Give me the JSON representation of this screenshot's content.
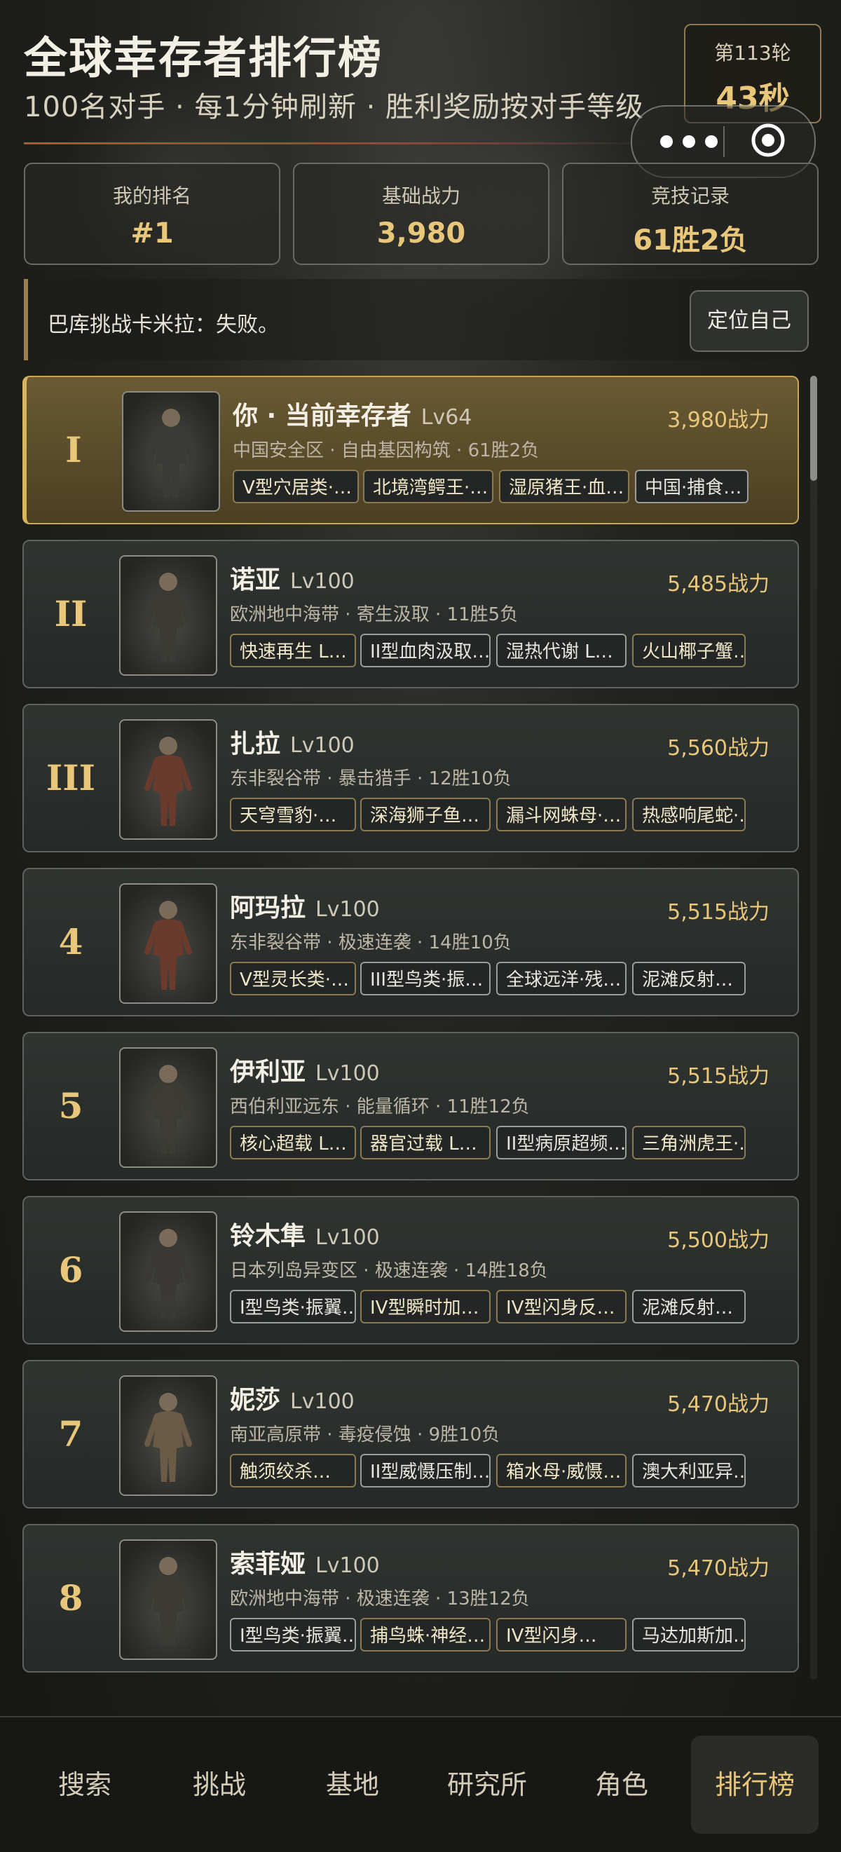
{
  "header": {
    "title": "全球幸存者排行榜",
    "subtitle": "100名对手 · 每1分钟刷新 · 胜利奖励按对手等级",
    "round_label": "第113轮",
    "round_time": "43秒"
  },
  "stats": [
    {
      "label": "我的排名",
      "value": "#1"
    },
    {
      "label": "基础战力",
      "value": "3,980"
    },
    {
      "label": "竞技记录",
      "value": "61胜2负"
    }
  ],
  "battle_log": "巴库挑战卡米拉：失败。",
  "locate_button": "定位自己",
  "entries": [
    {
      "rank": "I",
      "name": "你 · 当前幸存者",
      "level": "Lv64",
      "power": "3,980战力",
      "meta": "中国安全区 · 自由基因构筑 · 61胜2负",
      "tags": [
        {
          "text": "V型穴居类·…",
          "style": "gold"
        },
        {
          "text": "北境湾鳄王·…",
          "style": "gold"
        },
        {
          "text": "湿原猪王·血…",
          "style": "gold"
        },
        {
          "text": "中国·捕食…",
          "style": "silver"
        }
      ]
    },
    {
      "rank": "II",
      "name": "诺亚",
      "level": "Lv100",
      "power": "5,485战力",
      "meta": "欧洲地中海带 · 寄生汲取 · 11胜5负",
      "tags": [
        {
          "text": "快速再生 L…",
          "style": "gold"
        },
        {
          "text": "II型血肉汲取…",
          "style": "silver"
        },
        {
          "text": "湿热代谢 L…",
          "style": "silver"
        },
        {
          "text": "火山椰子蟹…",
          "style": "gold"
        }
      ]
    },
    {
      "rank": "III",
      "name": "扎拉",
      "level": "Lv100",
      "power": "5,560战力",
      "meta": "东非裂谷带 · 暴击猎手 · 12胜10负",
      "tags": [
        {
          "text": "天穹雪豹·…",
          "style": "gold"
        },
        {
          "text": "深海狮子鱼…",
          "style": "gold"
        },
        {
          "text": "漏斗网蛛母·…",
          "style": "gold"
        },
        {
          "text": "热感响尾蛇·…",
          "style": "gold"
        }
      ]
    },
    {
      "rank": "4",
      "name": "阿玛拉",
      "level": "Lv100",
      "power": "5,515战力",
      "meta": "东非裂谷带 · 极速连袭 · 14胜10负",
      "tags": [
        {
          "text": "V型灵长类·…",
          "style": "gold"
        },
        {
          "text": "III型鸟类·振…",
          "style": "silver"
        },
        {
          "text": "全球远洋·残…",
          "style": "silver"
        },
        {
          "text": "泥滩反射…",
          "style": "silver"
        }
      ]
    },
    {
      "rank": "5",
      "name": "伊利亚",
      "level": "Lv100",
      "power": "5,515战力",
      "meta": "西伯利亚远东 · 能量循环 · 11胜12负",
      "tags": [
        {
          "text": "核心超载 L…",
          "style": "gold"
        },
        {
          "text": "器官过载 L…",
          "style": "gold"
        },
        {
          "text": "II型病原超频…",
          "style": "silver"
        },
        {
          "text": "三角洲虎王·…",
          "style": "gold"
        }
      ]
    },
    {
      "rank": "6",
      "name": "铃木隼",
      "level": "Lv100",
      "power": "5,500战力",
      "meta": "日本列岛异变区 · 极速连袭 · 14胜18负",
      "tags": [
        {
          "text": "I型鸟类·振翼…",
          "style": "silver"
        },
        {
          "text": "IV型瞬时加…",
          "style": "gold"
        },
        {
          "text": "IV型闪身反…",
          "style": "gold"
        },
        {
          "text": "泥滩反射…",
          "style": "silver"
        }
      ]
    },
    {
      "rank": "7",
      "name": "妮莎",
      "level": "Lv100",
      "power": "5,470战力",
      "meta": "南亚高原带 · 毒疫侵蚀 · 9胜10负",
      "tags": [
        {
          "text": "触须绞杀…",
          "style": "gold"
        },
        {
          "text": "II型威慑压制…",
          "style": "silver"
        },
        {
          "text": "箱水母·威慑…",
          "style": "gold"
        },
        {
          "text": "澳大利亚异…",
          "style": "silver"
        }
      ]
    },
    {
      "rank": "8",
      "name": "索菲娅",
      "level": "Lv100",
      "power": "5,470战力",
      "meta": "欧洲地中海带 · 极速连袭 · 13胜12负",
      "tags": [
        {
          "text": "I型鸟类·振翼…",
          "style": "silver"
        },
        {
          "text": "捕鸟蛛·神经…",
          "style": "gold"
        },
        {
          "text": "IV型闪身…",
          "style": "gold"
        },
        {
          "text": "马达加斯加…",
          "style": "silver"
        }
      ]
    }
  ],
  "nav": {
    "items": [
      "搜索",
      "挑战",
      "基地",
      "研究所",
      "角色",
      "排行榜"
    ],
    "active": "排行榜"
  },
  "colors": {
    "accent": "#e8c77a",
    "highlight_card": "#5e4f2d",
    "card": "#2b302d",
    "rule": "#b8503a"
  }
}
